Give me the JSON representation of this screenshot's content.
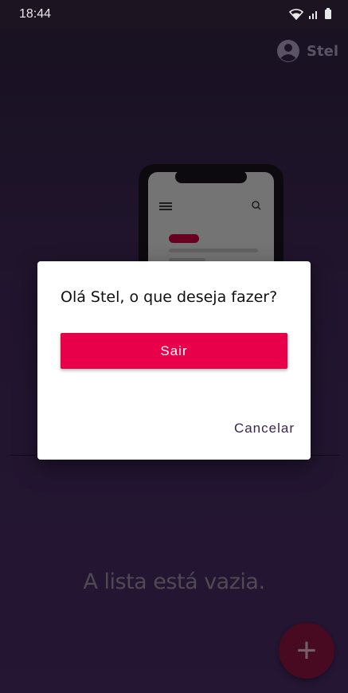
{
  "status_bar": {
    "time": "18:44",
    "icons": [
      "wifi-icon",
      "signal-icon",
      "battery-icon"
    ]
  },
  "header": {
    "user_name": "Stel",
    "avatar_icon": "account-circle-icon"
  },
  "main": {
    "empty_message": "A lista está vazia.",
    "fab_label": "+"
  },
  "dialog": {
    "title": "Olá Stel, o que deseja fazer?",
    "primary_label": "Sair",
    "cancel_label": "Cancelar"
  },
  "colors": {
    "accent": "#e8004a",
    "dialog_bg": "#ffffff",
    "cancel_text": "#3a2450"
  }
}
